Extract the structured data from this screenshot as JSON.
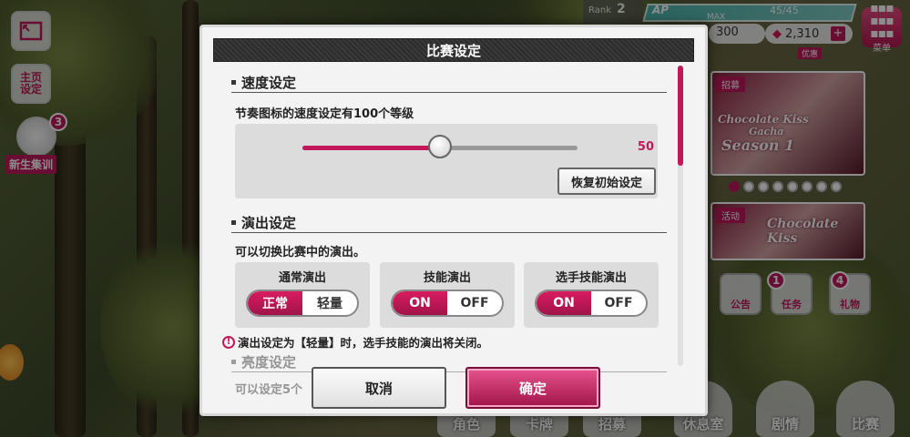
{
  "left_hud": {
    "home_settings": "主页\n设定",
    "event_badge_count": "3",
    "event_label": "新生集训"
  },
  "top_hud": {
    "rank_label": "Rank",
    "rank_value": "2",
    "ap_label": "AP",
    "ap_max_label": "MAX",
    "ap_value": "45/45",
    "coins": "300",
    "gems": "2,310",
    "menu_label": "菜单",
    "sale_label": "优惠"
  },
  "banners": {
    "banner1_tag": "招募",
    "banner1_title1": "Chocolate Kiss",
    "banner1_title2": "Gacha",
    "banner1_title3": "Season 1",
    "banner2_tag": "活动",
    "banner2_title": "Chocolate Kiss",
    "carousel_total": 8,
    "carousel_active": 0
  },
  "side_icons": {
    "notice": "公告",
    "mission": "任务",
    "mission_badge": "1",
    "gift": "礼物",
    "gift_badge": "4"
  },
  "bottom_nav": [
    "角色",
    "卡牌",
    "招募",
    "休息室",
    "剧情",
    "比赛"
  ],
  "dialog": {
    "title": "比赛设定",
    "speed": {
      "heading": "速度设定",
      "description": "节奏图标的速度设定有100个等级",
      "value": "50",
      "fraction": 0.5,
      "reset_label": "恢复初始设定"
    },
    "performance": {
      "heading": "演出设定",
      "description": "可以切换比赛中的演出。",
      "toggles": [
        {
          "title": "通常演出",
          "on_label": "正常",
          "off_label": "轻量"
        },
        {
          "title": "技能演出",
          "on_label": "ON",
          "off_label": "OFF"
        },
        {
          "title": "选手技能演出",
          "on_label": "ON",
          "off_label": "OFF"
        }
      ],
      "warning": "演出设定为【轻量】时，选手技能的演出将关闭。"
    },
    "brightness": {
      "heading": "亮度设定",
      "description": "可以设定5个"
    },
    "cancel_label": "取消",
    "confirm_label": "确定"
  }
}
